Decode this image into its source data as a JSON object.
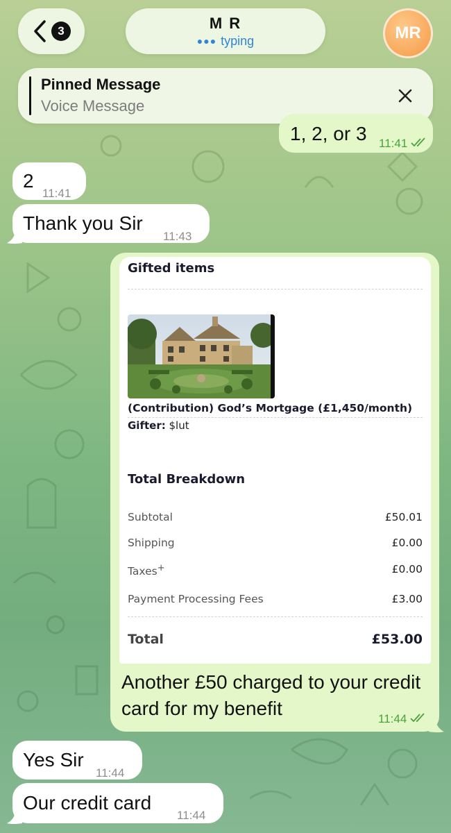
{
  "header": {
    "unread_count": "3",
    "contact_name": "M R",
    "status": "typing",
    "avatar_initials": "MR"
  },
  "pinned": {
    "title": "Pinned Message",
    "subtitle": "Voice Message"
  },
  "messages": [
    {
      "direction": "out",
      "text": "1, 2, or 3",
      "time": "11:41",
      "read": true
    },
    {
      "direction": "in",
      "text": "2",
      "time": "11:41"
    },
    {
      "direction": "in",
      "text": "Thank you Sir",
      "time": "11:43"
    },
    {
      "direction": "out",
      "text": "Another £50 charged to your credit card for my benefit",
      "time": "11:44",
      "read": true
    },
    {
      "direction": "in",
      "text": "Yes Sir",
      "time": "11:44"
    },
    {
      "direction": "in",
      "text": "Our credit card",
      "time": "11:44"
    }
  ],
  "receipt": {
    "heading": "Gifted items",
    "item_name": "(Contribution) God’s Mortgage (£1,450/month)",
    "gifter_label": "Gifter:",
    "gifter_value": "$lut",
    "breakdown_heading": "Total Breakdown",
    "rows": [
      {
        "label": "Subtotal",
        "amount": "£50.01"
      },
      {
        "label": "Shipping",
        "amount": "£0.00"
      },
      {
        "label": "Taxes",
        "sup": "+",
        "amount": "£0.00"
      },
      {
        "label": "Payment Processing Fees",
        "amount": "£3.00"
      }
    ],
    "total_label": "Total",
    "total_amount": "£53.00"
  },
  "colors": {
    "outgoing_bubble": "#e3f7c8",
    "incoming_bubble": "#ffffff",
    "read_check": "#4aa23b",
    "typing_blue": "#2f86d6",
    "avatar_orange": "#f59a47"
  }
}
